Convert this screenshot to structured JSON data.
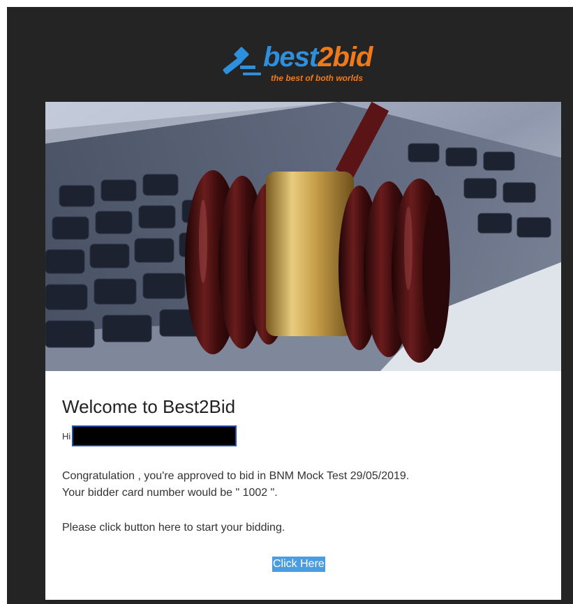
{
  "email": {
    "logo": {
      "brand_prefix": "best",
      "brand_suffix": "2bid",
      "tagline": "the best of both worlds",
      "icon": "gavel-icon"
    },
    "hero_image": "gavel-on-laptop-keyboard",
    "welcome_title": "Welcome to Best2Bid",
    "greeting": "Hi",
    "recipient_redacted": true,
    "line1": "Congratulation , you're approved to bid in BNM Mock Test 29/05/2019.",
    "line2": "Your bidder card number would be \" 1002 \".",
    "line3": "Please click button here to start your bidding.",
    "cta_label": "Click Here"
  },
  "colors": {
    "frame_bg": "#242424",
    "brand_blue": "#2e8fdc",
    "brand_orange": "#f07a1a",
    "cta_bg": "#4a9de0"
  }
}
